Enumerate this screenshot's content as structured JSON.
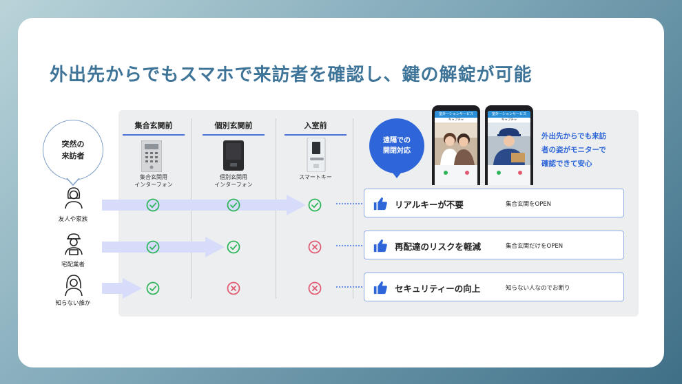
{
  "title": "外出先からでもスマホで来訪者を確認し、鍵の解錠が可能",
  "columns": [
    {
      "head": "集合玄関前",
      "device": [
        "集合玄関用",
        "インターフォン"
      ]
    },
    {
      "head": "個別玄関前",
      "device": [
        "個別玄関用",
        "インターフォン"
      ]
    },
    {
      "head": "入室前",
      "device": [
        "スマートキー"
      ]
    }
  ],
  "bubble": {
    "line1": "突然の",
    "line2": "来訪者"
  },
  "visitors": [
    {
      "label": "友人や家族",
      "icon": "woman-icon",
      "marks": [
        "check",
        "check",
        "check"
      ]
    },
    {
      "label": "宅配業者",
      "icon": "delivery-person-icon",
      "marks": [
        "check",
        "check",
        "cross"
      ]
    },
    {
      "label": "知らない誰か",
      "icon": "hooded-person-icon",
      "marks": [
        "check",
        "cross",
        "cross"
      ]
    }
  ],
  "remote": {
    "line1": "遠隔での",
    "line2": "開閉対応"
  },
  "phone_caption": [
    "外出先からでも来訪",
    "者の姿がモニターで",
    "確認できて安心"
  ],
  "phone_screen": {
    "app_bar": "室外ーションサービス",
    "sub_bar": "キャプチャ"
  },
  "benefits": [
    {
      "title": "リアルキーが不要",
      "sub": "集合玄関をOPEN"
    },
    {
      "title": "再配達のリスクを軽減",
      "sub": "集合玄関だけをOPEN"
    },
    {
      "title": "セキュリティーの向上",
      "sub": "知らない人なのでお断り"
    }
  ],
  "colors": {
    "check": "#2fb55a",
    "cross": "#e25a72",
    "accent": "#2e66d9",
    "title": "#3f7499",
    "arrow": "#d7dcfb"
  }
}
